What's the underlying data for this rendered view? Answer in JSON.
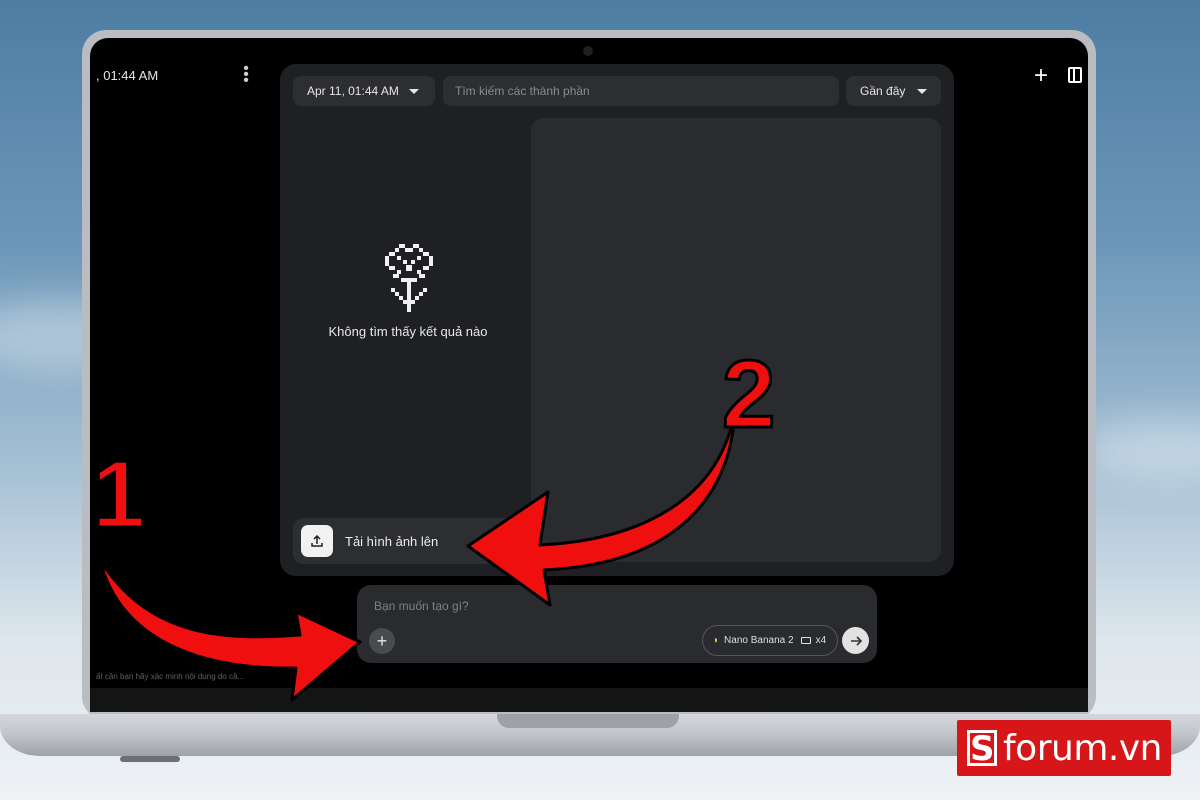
{
  "topbar": {
    "time_left": ", 01:44 AM"
  },
  "filters": {
    "date_label": "Apr 11, 01:44 AM",
    "search_placeholder": "Tìm kiếm các thành phần",
    "sort_label": "Gần đây"
  },
  "results": {
    "empty_message": "Không tìm thấy kết quả nào",
    "empty_icon": "flower-icon"
  },
  "upload": {
    "label": "Tải hình ảnh lên",
    "icon": "upload-icon"
  },
  "composer": {
    "placeholder": "Bạn muốn tạo gì?",
    "model_label": "Nano Banana 2",
    "count_label": "x4",
    "add_icon": "plus-icon",
    "send_icon": "arrow-right-icon"
  },
  "footer_text": "ất cần bạn hãy xác minh nội dung do câ...",
  "annotations": {
    "step1": "1",
    "step2": "2",
    "color": "#f00f0f"
  },
  "watermark": {
    "text": "forum.vn"
  }
}
